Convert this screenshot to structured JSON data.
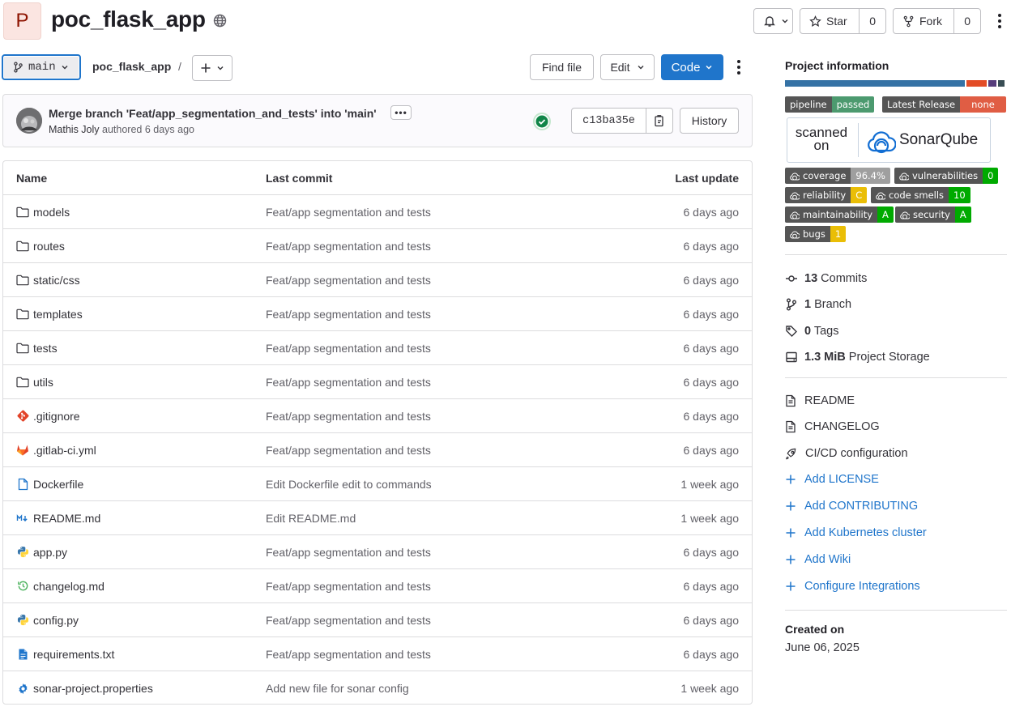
{
  "project": {
    "avatar_letter": "P",
    "name": "poc_flask_app",
    "visibility_icon": "globe-icon",
    "star_label": "Star",
    "star_count": "0",
    "fork_label": "Fork",
    "fork_count": "0"
  },
  "toolbar": {
    "branch": "main",
    "breadcrumb": "poc_flask_app",
    "breadcrumb_sep": "/",
    "find_file": "Find file",
    "edit": "Edit",
    "code": "Code"
  },
  "commit": {
    "title": "Merge branch 'Feat/app_segmentation_and_tests' into 'main'",
    "author": "Mathis Joly",
    "authored_text": "authored 6 days ago",
    "sha": "c13ba35e",
    "history": "History",
    "status": "passed"
  },
  "table": {
    "headers": {
      "name": "Name",
      "last_commit": "Last commit",
      "last_update": "Last update"
    },
    "rows": [
      {
        "name": "models",
        "icon": "folder-icon",
        "commit": "Feat/app segmentation and tests",
        "updated": "6 days ago"
      },
      {
        "name": "routes",
        "icon": "folder-icon",
        "commit": "Feat/app segmentation and tests",
        "updated": "6 days ago"
      },
      {
        "name": "static/css",
        "icon": "folder-icon",
        "commit": "Feat/app segmentation and tests",
        "updated": "6 days ago"
      },
      {
        "name": "templates",
        "icon": "folder-icon",
        "commit": "Feat/app segmentation and tests",
        "updated": "6 days ago"
      },
      {
        "name": "tests",
        "icon": "folder-icon",
        "commit": "Feat/app segmentation and tests",
        "updated": "6 days ago"
      },
      {
        "name": "utils",
        "icon": "folder-icon",
        "commit": "Feat/app segmentation and tests",
        "updated": "6 days ago"
      },
      {
        "name": ".gitignore",
        "icon": "git-icon",
        "commit": "Feat/app segmentation and tests",
        "updated": "6 days ago"
      },
      {
        "name": ".gitlab-ci.yml",
        "icon": "gitlab-icon",
        "commit": "Feat/app segmentation and tests",
        "updated": "6 days ago"
      },
      {
        "name": "Dockerfile",
        "icon": "file-icon",
        "commit": "Edit Dockerfile edit to commands",
        "updated": "1 week ago"
      },
      {
        "name": "README.md",
        "icon": "markdown-icon",
        "commit": "Edit README.md",
        "updated": "1 week ago"
      },
      {
        "name": "app.py",
        "icon": "python-icon",
        "commit": "Feat/app segmentation and tests",
        "updated": "6 days ago"
      },
      {
        "name": "changelog.md",
        "icon": "history-icon",
        "commit": "Feat/app segmentation and tests",
        "updated": "6 days ago"
      },
      {
        "name": "config.py",
        "icon": "python-icon",
        "commit": "Feat/app segmentation and tests",
        "updated": "6 days ago"
      },
      {
        "name": "requirements.txt",
        "icon": "document-icon",
        "commit": "Feat/app segmentation and tests",
        "updated": "6 days ago"
      },
      {
        "name": "sonar-project.properties",
        "icon": "gear-icon",
        "commit": "Add new file for sonar config",
        "updated": "1 week ago"
      }
    ]
  },
  "sidebar": {
    "title": "Project information",
    "language_colors": [
      "#3572a5",
      "#e34c26",
      "#563d7c",
      "#384d54"
    ],
    "language_shares": [
      0.83,
      0.09,
      0.04,
      0.03
    ],
    "badges": {
      "pipeline": {
        "label": "pipeline",
        "value": "passed",
        "color": "#4c9a6f"
      },
      "release": {
        "label": "Latest Release",
        "value": "none",
        "color": "#e05d44"
      }
    },
    "sonar_scanned": "scanned",
    "sonar_on": "on",
    "sonar_brand": "SonarQube",
    "sonar_badges": [
      {
        "label": "coverage",
        "value": "96.4%",
        "color": "#9f9f9f"
      },
      {
        "label": "vulnerabilities",
        "value": "0",
        "color": "#00aa00"
      },
      {
        "label": "reliability",
        "value": "C",
        "color": "#eabe06"
      },
      {
        "label": "code smells",
        "value": "10",
        "color": "#00aa00"
      },
      {
        "label": "maintainability",
        "value": "A",
        "color": "#00aa00"
      },
      {
        "label": "security",
        "value": "A",
        "color": "#00aa00"
      },
      {
        "label": "bugs",
        "value": "1",
        "color": "#eabe06"
      }
    ],
    "stats": {
      "commits_count": "13",
      "commits_label": "Commits",
      "branch_count": "1",
      "branch_label": "Branch",
      "tags_count": "0",
      "tags_label": "Tags",
      "storage_count": "1.3 MiB",
      "storage_label": "Project Storage"
    },
    "links": {
      "readme": "README",
      "changelog": "CHANGELOG",
      "cicd": "CI/CD configuration",
      "add_license": "Add LICENSE",
      "add_contributing": "Add CONTRIBUTING",
      "add_k8s": "Add Kubernetes cluster",
      "add_wiki": "Add Wiki",
      "configure": "Configure Integrations"
    },
    "created_label": "Created on",
    "created_date": "June 06, 2025"
  }
}
